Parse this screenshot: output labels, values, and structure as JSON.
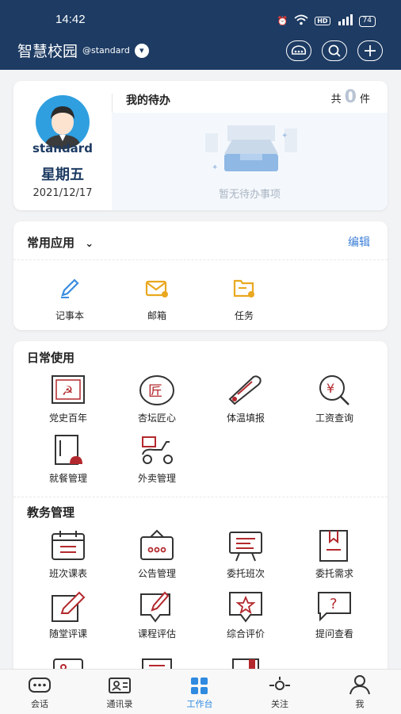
{
  "status_bar": {
    "time": "14:42",
    "battery": "74"
  },
  "header": {
    "title": "智慧校园",
    "account": "@standard"
  },
  "profile": {
    "username": "standard",
    "weekday": "星期五",
    "date": "2021/12/17"
  },
  "todo": {
    "title": "我的待办",
    "count_prefix": "共",
    "count": "0",
    "count_suffix": "件",
    "empty_text": "暂无待办事项"
  },
  "common_apps": {
    "title": "常用应用",
    "edit_label": "编辑",
    "items": [
      {
        "label": "记事本",
        "icon": "pen-icon"
      },
      {
        "label": "邮箱",
        "icon": "mail-icon"
      },
      {
        "label": "任务",
        "icon": "task-icon"
      }
    ]
  },
  "daily": {
    "title": "日常使用",
    "items": [
      {
        "label": "党史百年"
      },
      {
        "label": "杏坛匠心"
      },
      {
        "label": "体温填报"
      },
      {
        "label": "工资查询"
      },
      {
        "label": "就餐管理"
      },
      {
        "label": "外卖管理"
      }
    ]
  },
  "academic": {
    "title": "教务管理",
    "items": [
      {
        "label": "班次课表"
      },
      {
        "label": "公告管理"
      },
      {
        "label": "委托班次"
      },
      {
        "label": "委托需求"
      },
      {
        "label": "随堂评课"
      },
      {
        "label": "课程评估"
      },
      {
        "label": "综合评价"
      },
      {
        "label": "提问查看"
      }
    ]
  },
  "tabbar": {
    "items": [
      {
        "label": "会话"
      },
      {
        "label": "通讯录"
      },
      {
        "label": "工作台"
      },
      {
        "label": "关注"
      },
      {
        "label": "我"
      }
    ]
  },
  "colors": {
    "header_bg": "#1d3b63",
    "accent": "#2f8ae0",
    "icon_red": "#b3282d"
  }
}
